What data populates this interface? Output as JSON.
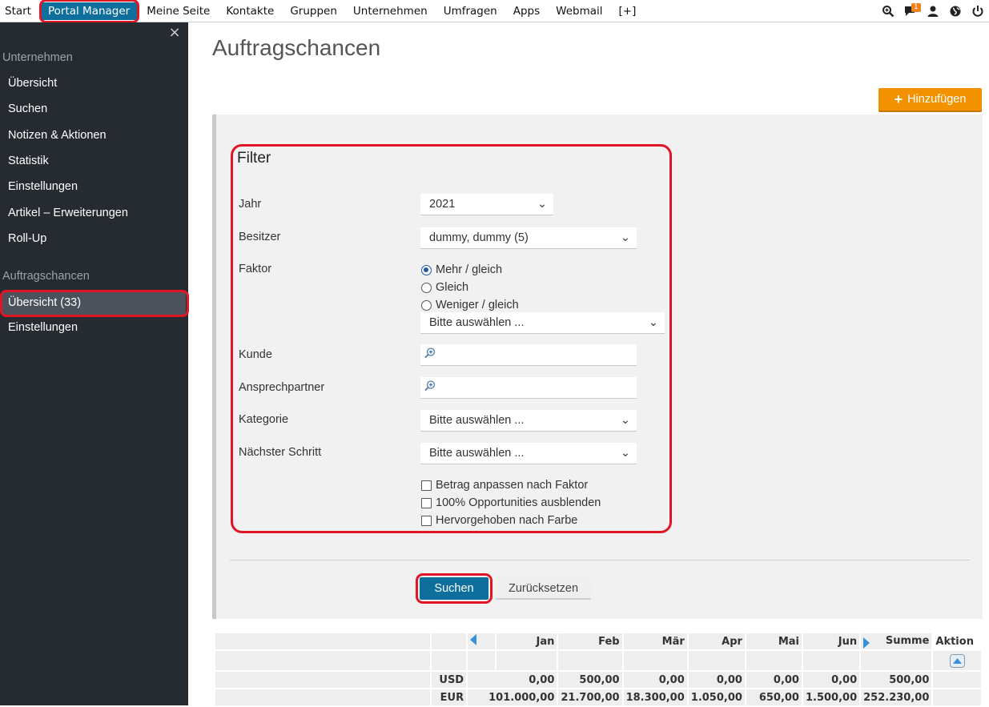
{
  "topnav": {
    "items": [
      "Start",
      "Portal Manager",
      "Meine Seite",
      "Kontakte",
      "Gruppen",
      "Unternehmen",
      "Umfragen",
      "Apps",
      "Webmail",
      "[+]"
    ],
    "active_index": 1,
    "messages_badge": "1"
  },
  "sidebar": {
    "close": "×",
    "section1_title": "Unternehmen",
    "section1_items": [
      "Übersicht",
      "Suchen",
      "Notizen & Aktionen",
      "Statistik",
      "Einstellungen",
      "Artikel – Erweiterungen",
      "Roll-Up"
    ],
    "section2_title": "Auftragschancen",
    "section2_items": [
      "Übersicht (33)",
      "Einstellungen"
    ]
  },
  "main": {
    "title": "Auftragschancen",
    "add_label": "Hinzufügen"
  },
  "filter": {
    "title": "Filter",
    "jahr_label": "Jahr",
    "jahr_value": "2021",
    "besitzer_label": "Besitzer",
    "besitzer_value": "dummy, dummy (5)",
    "faktor_label": "Faktor",
    "faktor_options": [
      "Mehr / gleich",
      "Gleich",
      "Weniger / gleich"
    ],
    "faktor_select": "Bitte auswählen ...",
    "kunde_label": "Kunde",
    "ansprechpartner_label": "Ansprechpartner",
    "kategorie_label": "Kategorie",
    "kategorie_value": "Bitte auswählen ...",
    "schritt_label": "Nächster Schritt",
    "schritt_value": "Bitte auswählen ...",
    "checkboxes": [
      "Betrag anpassen nach Faktor",
      "100% Opportunities ausblenden",
      "Hervorgehoben nach Farbe"
    ],
    "search_label": "Suchen",
    "reset_label": "Zurücksetzen"
  },
  "stats": {
    "months": [
      "Jan",
      "Feb",
      "Mär",
      "Apr",
      "Mai",
      "Jun"
    ],
    "sum_label": "Summe",
    "action_label": "Aktion",
    "rows": [
      {
        "currency": "USD",
        "values": [
          "0,00",
          "500,00",
          "0,00",
          "0,00",
          "0,00",
          "0,00"
        ],
        "sum": "500,00"
      },
      {
        "currency": "EUR",
        "values": [
          "101.000,00",
          "21.700,00",
          "18.300,00",
          "1.050,00",
          "650,00",
          "1.500,00"
        ],
        "sum": "252.230,00"
      }
    ]
  }
}
